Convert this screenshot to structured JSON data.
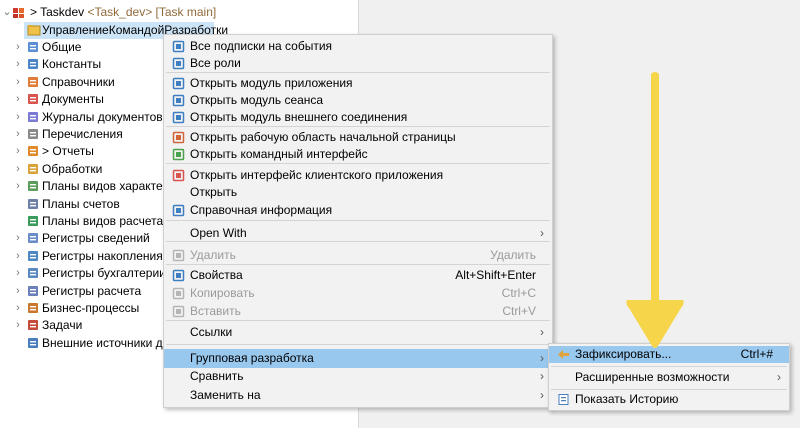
{
  "tree": {
    "root": {
      "label": "Taskdev",
      "suffix": "<Task_dev> [Task main]"
    },
    "selected": "УправлениеКомандойРазработки",
    "items": [
      {
        "label": "Общие",
        "icon": "common-icon"
      },
      {
        "label": "Константы",
        "icon": "constants-icon"
      },
      {
        "label": "Справочники",
        "icon": "catalogs-icon"
      },
      {
        "label": "Документы",
        "icon": "documents-icon"
      },
      {
        "label": "Журналы документов",
        "icon": "journals-icon"
      },
      {
        "label": "Перечисления",
        "icon": "enums-icon"
      },
      {
        "label": "> Отчеты",
        "icon": "reports-icon"
      },
      {
        "label": "Обработки",
        "icon": "processings-icon"
      },
      {
        "label": "Планы видов характери",
        "icon": "chart-char-icon"
      },
      {
        "label": "Планы счетов",
        "icon": "chart-accounts-icon"
      },
      {
        "label": "Планы видов расчета",
        "icon": "chart-calc-icon"
      },
      {
        "label": "Регистры сведений",
        "icon": "info-registers-icon"
      },
      {
        "label": "Регистры накопления",
        "icon": "accum-registers-icon"
      },
      {
        "label": "Регистры бухгалтерии",
        "icon": "acc-registers-icon"
      },
      {
        "label": "Регистры расчета",
        "icon": "calc-registers-icon"
      },
      {
        "label": "Бизнес-процессы",
        "icon": "bp-icon"
      },
      {
        "label": "Задачи",
        "icon": "tasks-icon"
      },
      {
        "label": "Внешние источники дан",
        "icon": "external-sources-icon"
      }
    ]
  },
  "context_menu": {
    "items": [
      {
        "label": "Все подписки на события",
        "icon": "subscriptions-icon"
      },
      {
        "label": "Все роли",
        "icon": "roles-icon"
      },
      {
        "label": "Открыть модуль приложения",
        "icon": "module-icon"
      },
      {
        "label": "Открыть модуль сеанса",
        "icon": "module-icon"
      },
      {
        "label": "Открыть модуль внешнего соединения",
        "icon": "module-icon"
      },
      {
        "label": "Открыть рабочую область начальной страницы",
        "icon": "home-icon"
      },
      {
        "label": "Открыть командный интерфейс",
        "icon": "pencil-icon"
      },
      {
        "label": "Открыть интерфейс клиентского приложения",
        "icon": "client-ui-icon"
      },
      {
        "label": "Открыть",
        "icon": ""
      },
      {
        "label": "Справочная информация",
        "icon": "help-icon"
      },
      {
        "label": "Open With",
        "arrow": "›"
      },
      {
        "label": "Удалить",
        "shortcut": "Удалить",
        "icon": "delete-icon",
        "disabled": true
      },
      {
        "label": "Свойства",
        "shortcut": "Alt+Shift+Enter",
        "icon": "properties-icon"
      },
      {
        "label": "Копировать",
        "shortcut": "Ctrl+C",
        "icon": "copy-icon",
        "disabled": true
      },
      {
        "label": "Вставить",
        "shortcut": "Ctrl+V",
        "icon": "paste-icon",
        "disabled": true
      },
      {
        "label": "Ссылки",
        "arrow": "›"
      },
      {
        "label": "Групповая разработка",
        "arrow": "›",
        "highlighted": true
      },
      {
        "label": "Сравнить",
        "arrow": "›"
      },
      {
        "label": "Заменить на",
        "arrow": "›"
      }
    ]
  },
  "submenu": {
    "items": [
      {
        "label": "Зафиксировать...",
        "shortcut": "Ctrl+#",
        "icon": "commit-icon",
        "highlighted": true
      },
      {
        "label": "Расширенные возможности",
        "arrow": "›"
      },
      {
        "label": "Показать Историю",
        "icon": "history-icon"
      }
    ]
  },
  "annotation": {
    "arrow_color": "#f7d54a"
  }
}
